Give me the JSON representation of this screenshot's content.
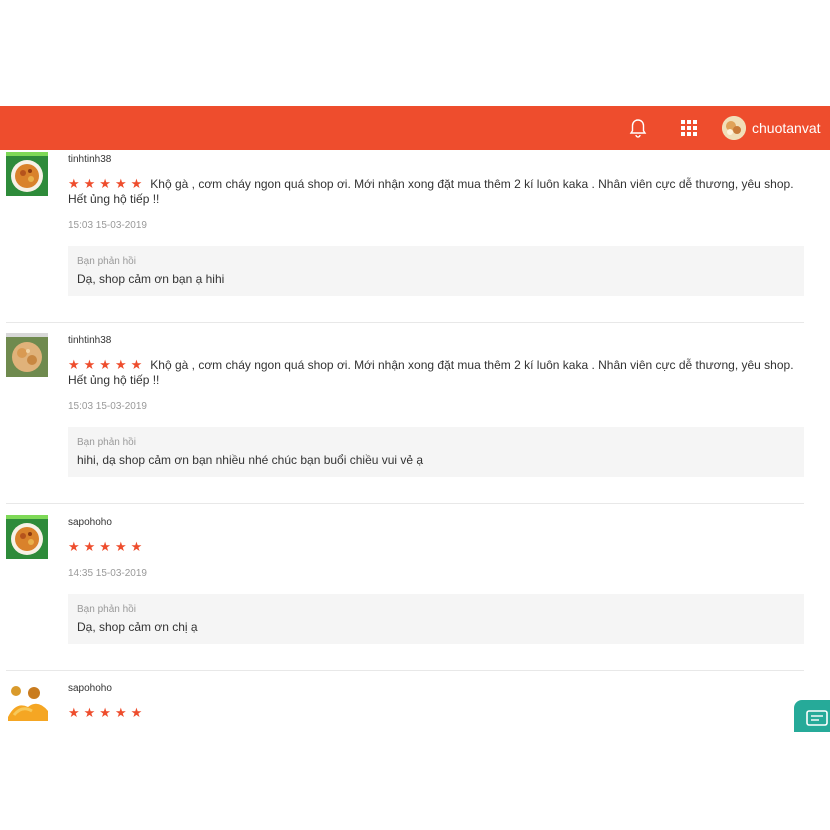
{
  "header": {
    "username": "chuotanvat",
    "bell_icon": "bell-icon",
    "apps_icon": "apps-grid-icon",
    "accent_color": "#ee4d2d"
  },
  "reviews": [
    {
      "name": "tinhtinh38",
      "stars": "★★★★★",
      "rating": 5,
      "text": "Khộ gà , cơm cháy ngon quá shop ơi. Mới nhận xong đặt mua thêm 2 kí luôn kaka . Nhân viên cực dễ thương, yêu shop. Hết ủng hộ tiếp !!",
      "time": "15:03 15-03-2019",
      "reply_label": "Bạn phản hồi",
      "reply_text": "Dạ, shop cảm ơn bạn ạ hihi"
    },
    {
      "name": "tinhtinh38",
      "stars": "★★★★★",
      "rating": 5,
      "text": "Khộ gà , cơm cháy ngon quá shop ơi. Mới nhận xong đặt mua thêm 2 kí luôn kaka . Nhân viên cực dễ thương, yêu shop. Hết ủng hộ tiếp !!",
      "time": "15:03 15-03-2019",
      "reply_label": "Bạn phản hồi",
      "reply_text": "hihi, dạ shop cảm ơn bạn nhiều nhé chúc bạn buổi chiều vui vẻ ạ"
    },
    {
      "name": "sapohoho",
      "stars": "★★★★★",
      "rating": 5,
      "text": "",
      "time": "14:35 15-03-2019",
      "reply_label": "Bạn phản hồi",
      "reply_text": "Dạ, shop cảm ơn chị ạ"
    },
    {
      "name": "sapohoho",
      "stars": "★★★★★",
      "rating": 5
    }
  ]
}
